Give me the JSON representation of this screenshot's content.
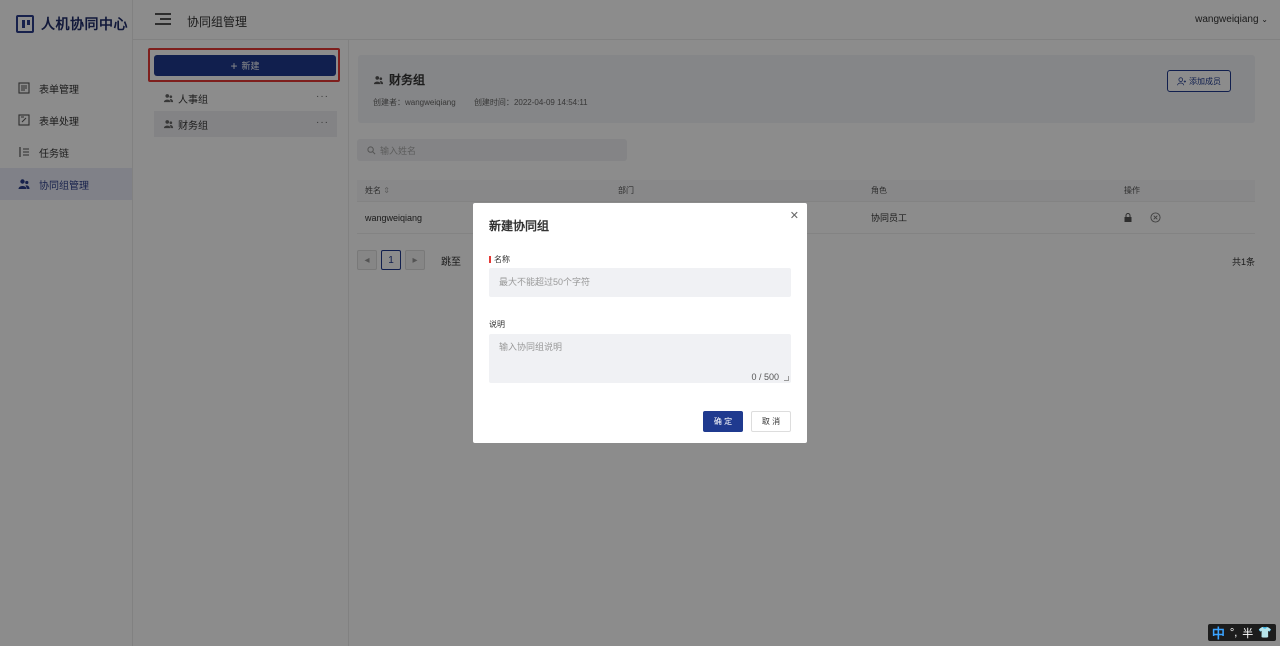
{
  "app": {
    "logo_text": "人机协同中心"
  },
  "sidebar": {
    "items": [
      {
        "label": "表单管理",
        "icon": "form-list-icon"
      },
      {
        "label": "表单处理",
        "icon": "form-edit-icon"
      },
      {
        "label": "任务链",
        "icon": "task-chain-icon"
      },
      {
        "label": "协同组管理",
        "icon": "user-group-icon",
        "active": true
      }
    ]
  },
  "topbar": {
    "page_title": "协同组管理",
    "user": "wangweiqiang"
  },
  "groups": {
    "new_label": "新建",
    "items": [
      {
        "name": "人事组",
        "more": "···"
      },
      {
        "name": "财务组",
        "more": "···",
        "active": true
      }
    ]
  },
  "detail": {
    "name": "财务组",
    "creator_label": "创建者：",
    "creator": "wangweiqiang",
    "created_label": "创建时间：",
    "created_at": "2022-04-09 14:54:11",
    "add_member_label": "添加成员"
  },
  "search": {
    "placeholder": "输入姓名"
  },
  "table": {
    "headers": [
      "姓名",
      "部门",
      "角色",
      "操作"
    ],
    "rows": [
      {
        "name": "wangweiqiang",
        "dept": "",
        "role": "协同员工"
      }
    ]
  },
  "pager": {
    "current": "1",
    "jump_label": "跳至",
    "total": "共1条"
  },
  "modal": {
    "title": "新建协同组",
    "name_label": "名称",
    "name_placeholder": "最大不能超过50个字符",
    "desc_label": "说明",
    "desc_placeholder": "输入协同组说明",
    "counter": "0 / 500",
    "ok": "确 定",
    "cancel": "取 消"
  },
  "ime": {
    "mode": "中",
    "punct": "°,",
    "width": "半"
  },
  "colors": {
    "primary": "#1f3a8f",
    "highlight": "#e53935"
  }
}
